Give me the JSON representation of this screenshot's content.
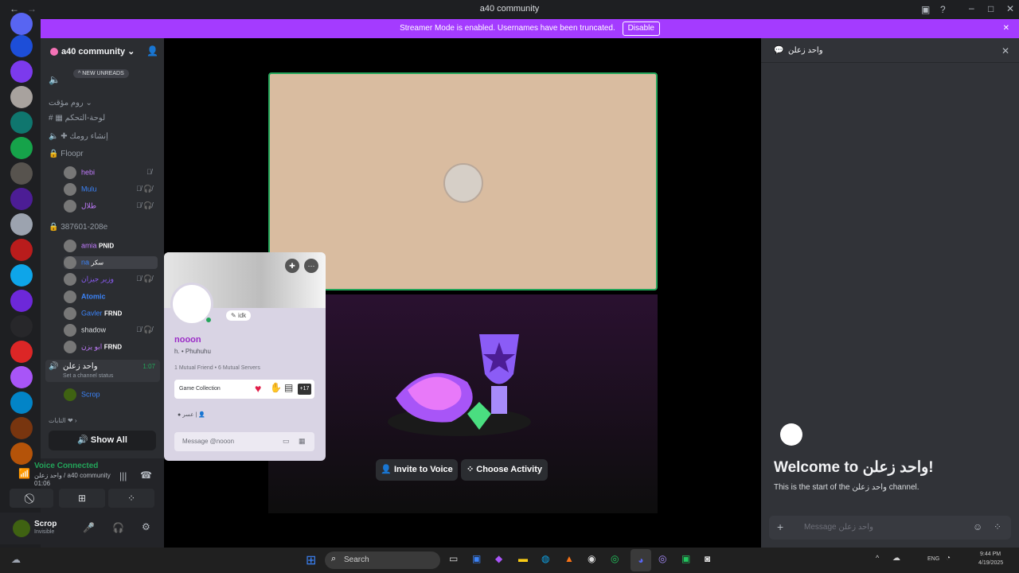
{
  "window": {
    "title": "a40 community"
  },
  "streamer": {
    "message": "Streamer Mode is enabled. Usernames have been truncated.",
    "disable_label": "Disable"
  },
  "server": {
    "name": "a40 community"
  },
  "sidebar": {
    "new_unreads": "NEW UNREADS",
    "category_temp": "روم مؤقت",
    "channel_dashboard": "لوحة-التحكم",
    "channel_create": "إنشاء رومك",
    "voice_1": "Floopr",
    "voice_1_members": [
      {
        "name": "hebi",
        "color": "#c27cff"
      },
      {
        "name": "Mulu",
        "color": "#3b82f6"
      },
      {
        "name": "طلال",
        "color": "#c27cff"
      }
    ],
    "voice_2": "387601-208e",
    "voice_2_members": [
      {
        "name": "amia",
        "badge": "PNID",
        "color": "#c27cff"
      },
      {
        "name": "na",
        "badge": "سكر",
        "color": "#3b82f6"
      },
      {
        "name": "وزير جيزان",
        "badge": "",
        "color": "#8b5cf6"
      },
      {
        "name": "Atomic",
        "badge": "",
        "color": "#3b82f6"
      },
      {
        "name": "Gavler",
        "badge": "FRND",
        "color": "#3b82f6"
      },
      {
        "name": "shadow",
        "badge": "",
        "color": "#dbdee1"
      },
      {
        "name": "ابو يزن",
        "badge": "FRND",
        "color": "#c27cff"
      }
    ],
    "voice_3": "واحد زعلن",
    "voice_3_time": "1:07",
    "voice_3_status": "Set a channel status",
    "voice_3_member": "Scrop",
    "category_2": "التابات",
    "show_all": "Show All"
  },
  "voice_panel": {
    "status": "Voice Connected",
    "channel": "واحد زعلن / a40 community",
    "time": "01:06"
  },
  "user": {
    "name": "Scrop",
    "status": "Invisible"
  },
  "popup": {
    "name": "nooon",
    "subtitle": "h.  •  Phuhuhu",
    "custom_status": "idk",
    "mutual": "1 Mutual Friend  •  6 Mutual Servers",
    "game_label": "Game Collection",
    "game_more": "+17",
    "role": "عسر",
    "message_placeholder": "Message @nooon"
  },
  "main": {
    "invite_label": "Invite to Voice",
    "activity_label": "Choose Activity"
  },
  "chat": {
    "header": "واحد زعلن",
    "welcome_title": "Welcome to واحد زعلن!",
    "welcome_sub": "This is the start of the واحد زعلن channel.",
    "input_placeholder": "Message واحد زعلن"
  },
  "taskbar": {
    "search": "Search",
    "time": "9:44 PM",
    "date": "4/19/2025",
    "lang": "ENG"
  }
}
